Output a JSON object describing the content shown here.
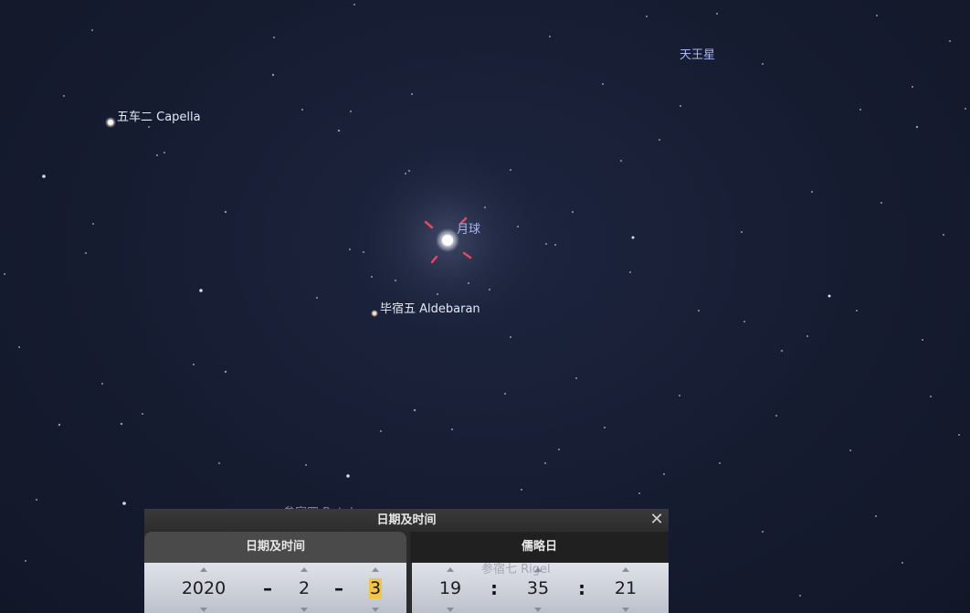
{
  "sky": {
    "labels": {
      "uranus": "天王星",
      "capella": "五车二 Capella",
      "moon": "月球",
      "aldebaran": "毕宿五 Aldebaran",
      "betelgeuse": "参宿四 Betelgeuse",
      "rigel": "参宿七 Rigel"
    },
    "colors": {
      "background": "#161c30",
      "planet_label": "#a9b6f2",
      "marker": "#e8485a"
    }
  },
  "dialog": {
    "title": "日期及时间",
    "close_icon": "close-icon",
    "tabs": {
      "datetime": "日期及时间",
      "julian": "儒略日"
    },
    "date": {
      "year": "2020",
      "month": "2",
      "day": "3",
      "separator": "–"
    },
    "time": {
      "hour": "19",
      "minute": "35",
      "second": "21",
      "separator": ":"
    }
  }
}
